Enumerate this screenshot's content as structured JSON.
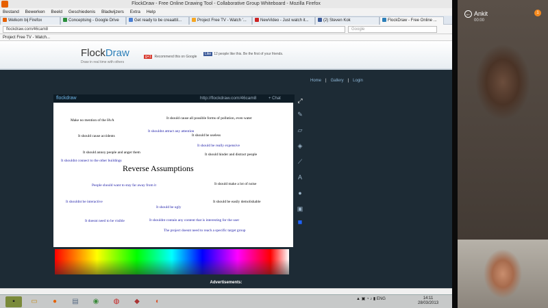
{
  "window": {
    "title": "FlockDraw - Free Online Drawing Tool - Collaborative Group Whiteboard - Mozilla Firefox"
  },
  "menu": [
    "Bestand",
    "Bewerken",
    "Beeld",
    "Geschiedenis",
    "Bladwijzers",
    "Extra",
    "Help"
  ],
  "tabs": [
    {
      "label": "Welkom bij Firefox",
      "color": "#e66000"
    },
    {
      "label": "Conceptsing - Google Drive",
      "color": "#2a8f3c"
    },
    {
      "label": "Get ready to be creaattil...",
      "color": "#4a7fd4"
    },
    {
      "label": "Project Free TV - Watch '...",
      "color": "#f5a623"
    },
    {
      "label": "NewVideo - Just watch it...",
      "color": "#cc2222"
    },
    {
      "label": "(2) Steven Kok",
      "color": "#3b5998"
    },
    {
      "label": "FlockDraw - Free Online ...",
      "color": "#2c7fb8",
      "active": true
    }
  ],
  "url": "flockdraw.com/46cam8",
  "search_placeholder": "Google",
  "bookmark": "Project Free TV - Watch...",
  "site": {
    "logo_a": "Flock",
    "logo_b": "Draw",
    "tagline": "Draw in real time with others",
    "gplus": "Recommend this on Google",
    "fb": "Like",
    "fb_text": "12 people like this. Be the first of your friends.",
    "nav_home": "Home",
    "nav_gallery": "Gallery",
    "nav_login": "Login"
  },
  "board": {
    "brand": "flockdraw",
    "url": "http://flockdraw.com/46cam8",
    "chat": "+ Chat",
    "heading": "Reverse Assumptions",
    "notes": [
      {
        "text": "Make no mention of the HvA",
        "c": "bl"
      },
      {
        "text": "It should cause all possible forms of pollution, even water",
        "c": "bl"
      },
      {
        "text": "It shouldnt attract any attention",
        "c": "bu"
      },
      {
        "text": "It should cause accidents",
        "c": "bl"
      },
      {
        "text": "It should be useless",
        "c": "bl"
      },
      {
        "text": "It should be really expensive",
        "c": "bu"
      },
      {
        "text": "It should annoy people and anger them",
        "c": "bl"
      },
      {
        "text": "It should hinder and distract people",
        "c": "bl"
      },
      {
        "text": "It shouldnt connect to the other buildings",
        "c": "bu"
      },
      {
        "text": "People should want to stay far away from it",
        "c": "bu"
      },
      {
        "text": "It should make a lot of noise",
        "c": "bl"
      },
      {
        "text": "It shouldnt be interactive",
        "c": "bu"
      },
      {
        "text": "It should be ugly",
        "c": "bu"
      },
      {
        "text": "It should be easily demolishable",
        "c": "bl"
      },
      {
        "text": "It doesnt need to be visible",
        "c": "bu"
      },
      {
        "text": "It shouldnt contain any content that is interesting for the user",
        "c": "bu"
      },
      {
        "text": "The project doesnt need to reach a specific target group",
        "c": "bu"
      }
    ]
  },
  "ads": "Advertisements:",
  "tray": {
    "lang": "ENG",
    "time": "14:11",
    "date": "28/03/2013"
  },
  "call": {
    "name": "Ankit",
    "time": "00:00",
    "badge": "1"
  }
}
